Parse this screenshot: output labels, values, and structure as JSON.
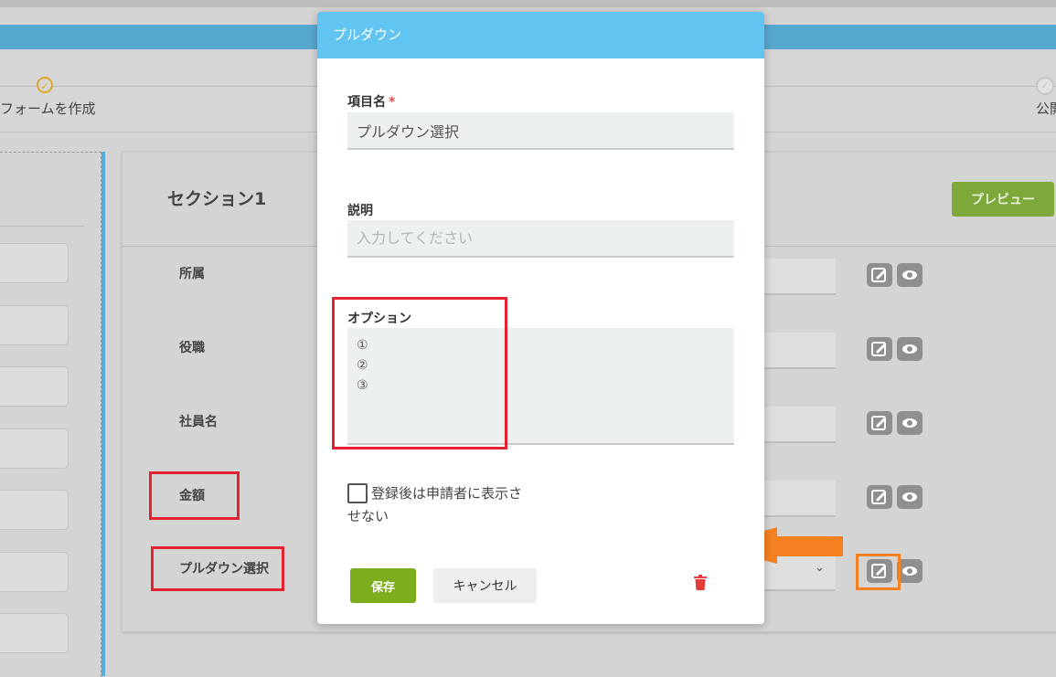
{
  "stepper": {
    "step1_label": "フォームを作成",
    "step2_label": "公開"
  },
  "section": {
    "title": "セクション1",
    "preview_label": "プレビュー",
    "fields": [
      {
        "label": "所属"
      },
      {
        "label": "役職"
      },
      {
        "label": "社員名"
      },
      {
        "label": "金額"
      },
      {
        "label": "プルダウン選択"
      }
    ]
  },
  "modal": {
    "title": "プルダウン",
    "item_name_label": "項目名",
    "required_mark": "*",
    "item_name_value": "プルダウン選択",
    "description_label": "説明",
    "description_placeholder": "入力してください",
    "options_label": "オプション",
    "options": [
      "①",
      "②",
      "③"
    ],
    "hide_checkbox_label_line1": "登録後は申請者に表示さ",
    "hide_checkbox_label_line2": "せない",
    "save_label": "保存",
    "cancel_label": "キャンセル"
  },
  "icons": {
    "step_done": "check-circle-icon",
    "step_pending": "check-circle-icon",
    "edit": "edit-icon",
    "visibility": "eye-icon",
    "dropdown": "chevron-down-icon",
    "delete": "trash-icon",
    "annotation_arrow": "arrow-left-icon"
  },
  "colors": {
    "header_blue": "#62c4f0",
    "save_green": "#7cad1d",
    "preview_green": "#7fa83a",
    "annotation_red": "#e3212f",
    "annotation_orange": "#f5801f",
    "delete_red": "#e63b3b"
  }
}
